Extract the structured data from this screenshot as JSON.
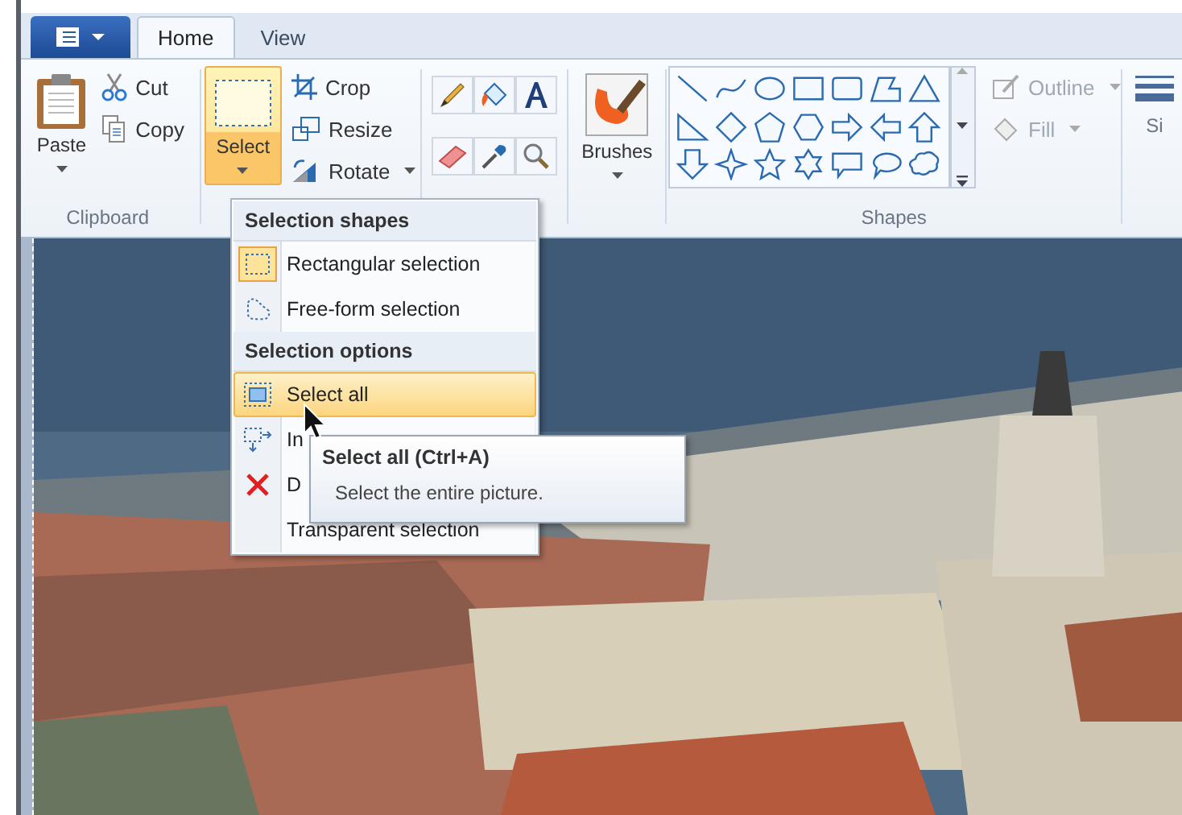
{
  "tabs": [
    {
      "label": "Home",
      "selected": true
    },
    {
      "label": "View",
      "selected": false
    }
  ],
  "clipboard": {
    "label": "Clipboard",
    "paste": "Paste",
    "cut": "Cut",
    "copy": "Copy"
  },
  "image": {
    "select": {
      "label": "Select",
      "pressed": true
    },
    "crop": "Crop",
    "resize": "Resize",
    "rotate": "Rotate"
  },
  "brushes": {
    "label": "Brushes"
  },
  "shapes": {
    "label": "Shapes",
    "outline": {
      "label": "Outline",
      "disabled": true
    },
    "fill": {
      "label": "Fill",
      "disabled": true
    }
  },
  "size": {
    "label": "Si"
  },
  "select_menu": {
    "sections": [
      {
        "header": "Selection shapes",
        "items": [
          {
            "label": "Rectangular selection",
            "kind": "rect",
            "selected": true,
            "highlighted": false
          },
          {
            "label": "Free-form selection",
            "kind": "freeform",
            "selected": false,
            "highlighted": false
          }
        ]
      },
      {
        "header": "Selection options",
        "items": [
          {
            "label": "Select all",
            "kind": "all",
            "selected": false,
            "highlighted": true
          },
          {
            "label": "In",
            "kind": "invert",
            "selected": false,
            "highlighted": false
          },
          {
            "label": "D",
            "kind": "delete",
            "selected": false,
            "highlighted": false
          },
          {
            "label": "Transparent selection",
            "kind": "transparent",
            "selected": false,
            "highlighted": false
          }
        ]
      }
    ]
  },
  "tooltip": {
    "title": "Select all (Ctrl+A)",
    "text": "Select the entire picture."
  }
}
